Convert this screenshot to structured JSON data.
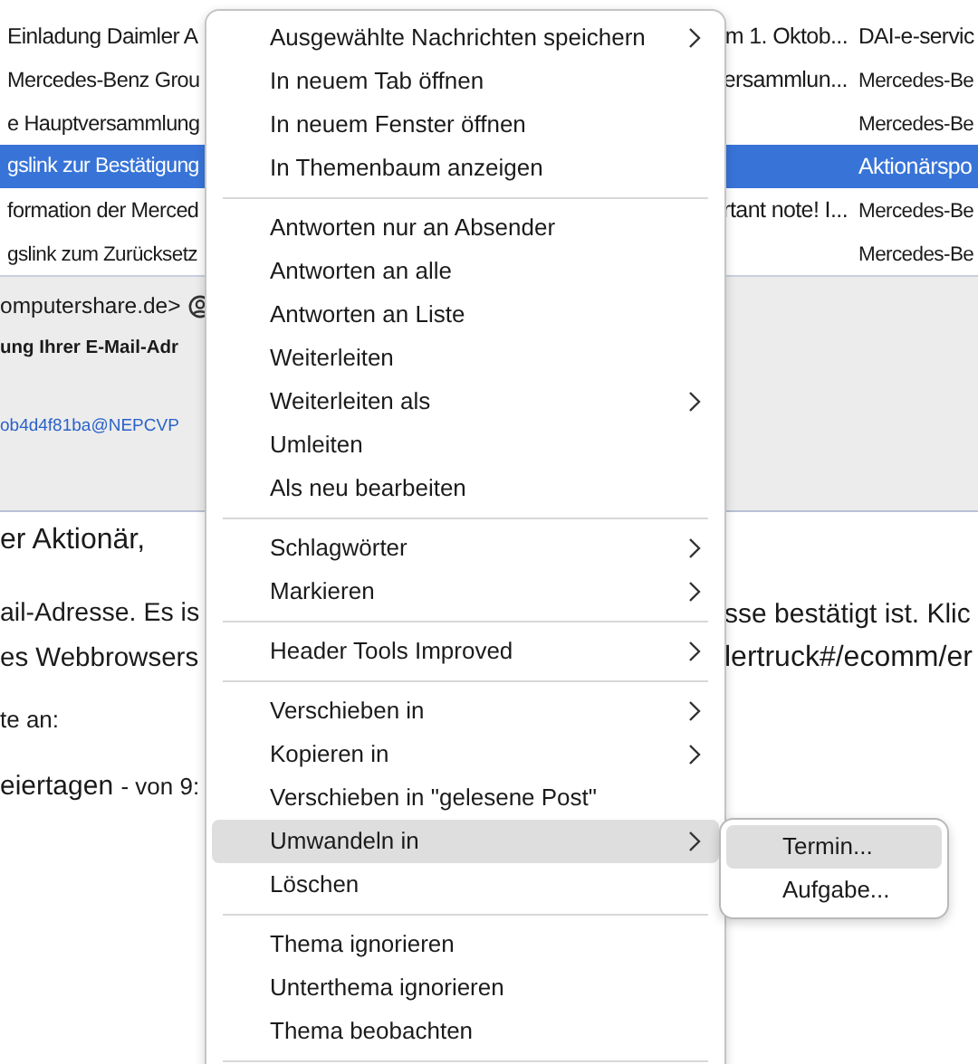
{
  "message_list": {
    "rows": [
      {
        "column_1": "Einladung Daimler A",
        "column_2": "m 1. Oktob...",
        "column_3": "DAI-e-servic",
        "selected": false
      },
      {
        "column_1": "Mercedes-Benz Grou",
        "column_2": "ersammlun...",
        "column_3": "Mercedes-Be",
        "selected": false
      },
      {
        "column_1": "e Hauptversammlung",
        "column_3": "Mercedes-Be",
        "selected": false
      },
      {
        "column_1": "gslink zur Bestätigung",
        "column_3": "Aktionärspo",
        "selected": true
      },
      {
        "column_1": "formation der Merced",
        "column_2": "rtant note! I...",
        "column_3": "Mercedes-Be",
        "selected": false
      },
      {
        "column_1": "gslink zum Zurücksetz",
        "column_3": "Mercedes-Be",
        "selected": false
      }
    ]
  },
  "message_header": {
    "from": "omputershare.de>",
    "subject": "ung Ihrer E-Mail-Adr",
    "message_id": "ob4d4f81ba@NEPCVP"
  },
  "message_body": [
    {
      "kind": "line",
      "text": "er Aktionär,"
    },
    {
      "kind": "split",
      "text": "ail-Adresse. Es is",
      "right_text": "sse bestätigt ist. Klic"
    },
    {
      "kind": "split",
      "text": "es Webbrowsers",
      "right_text": "lertruck#/ecomm/er"
    },
    {
      "kind": "small",
      "text": "te an:"
    },
    {
      "kind": "mixed",
      "text": "eiertagen",
      "small_text": "- von 9:"
    }
  ],
  "context_menu": {
    "items": [
      {
        "kind": "item",
        "label": "Ausgewählte Nachrichten speichern",
        "has_submenu": true,
        "highlighted": false
      },
      {
        "kind": "item",
        "label": "In neuem Tab öffnen",
        "has_submenu": false,
        "highlighted": false
      },
      {
        "kind": "item",
        "label": "In neuem Fenster öffnen",
        "has_submenu": false,
        "highlighted": false
      },
      {
        "kind": "item",
        "label": "In Themenbaum anzeigen",
        "has_submenu": false,
        "highlighted": false
      },
      {
        "kind": "separator"
      },
      {
        "kind": "item",
        "label": "Antworten nur an Absender",
        "has_submenu": false,
        "highlighted": false
      },
      {
        "kind": "item",
        "label": "Antworten an alle",
        "has_submenu": false,
        "highlighted": false
      },
      {
        "kind": "item",
        "label": "Antworten an Liste",
        "has_submenu": false,
        "highlighted": false
      },
      {
        "kind": "item",
        "label": "Weiterleiten",
        "has_submenu": false,
        "highlighted": false
      },
      {
        "kind": "item",
        "label": "Weiterleiten als",
        "has_submenu": true,
        "highlighted": false
      },
      {
        "kind": "item",
        "label": "Umleiten",
        "has_submenu": false,
        "highlighted": false
      },
      {
        "kind": "item",
        "label": "Als neu bearbeiten",
        "has_submenu": false,
        "highlighted": false
      },
      {
        "kind": "separator"
      },
      {
        "kind": "item",
        "label": "Schlagwörter",
        "has_submenu": true,
        "highlighted": false
      },
      {
        "kind": "item",
        "label": "Markieren",
        "has_submenu": true,
        "highlighted": false
      },
      {
        "kind": "separator"
      },
      {
        "kind": "item",
        "label": "Header Tools Improved",
        "has_submenu": true,
        "highlighted": false
      },
      {
        "kind": "separator"
      },
      {
        "kind": "item",
        "label": "Verschieben in",
        "has_submenu": true,
        "highlighted": false
      },
      {
        "kind": "item",
        "label": "Kopieren in",
        "has_submenu": true,
        "highlighted": false
      },
      {
        "kind": "item",
        "label": "Verschieben in \"gelesene Post\"",
        "has_submenu": false,
        "highlighted": false
      },
      {
        "kind": "item",
        "label": "Umwandeln in",
        "has_submenu": true,
        "highlighted": true
      },
      {
        "kind": "item",
        "label": "Löschen",
        "has_submenu": false,
        "highlighted": false
      },
      {
        "kind": "separator"
      },
      {
        "kind": "item",
        "label": "Thema ignorieren",
        "has_submenu": false,
        "highlighted": false
      },
      {
        "kind": "item",
        "label": "Unterthema ignorieren",
        "has_submenu": false,
        "highlighted": false
      },
      {
        "kind": "item",
        "label": "Thema beobachten",
        "has_submenu": false,
        "highlighted": false
      },
      {
        "kind": "separator"
      }
    ]
  },
  "submenu": {
    "items": [
      {
        "kind": "item",
        "label": "Termin...",
        "highlighted": true
      },
      {
        "kind": "item",
        "label": "Aufgabe...",
        "highlighted": false
      }
    ]
  }
}
